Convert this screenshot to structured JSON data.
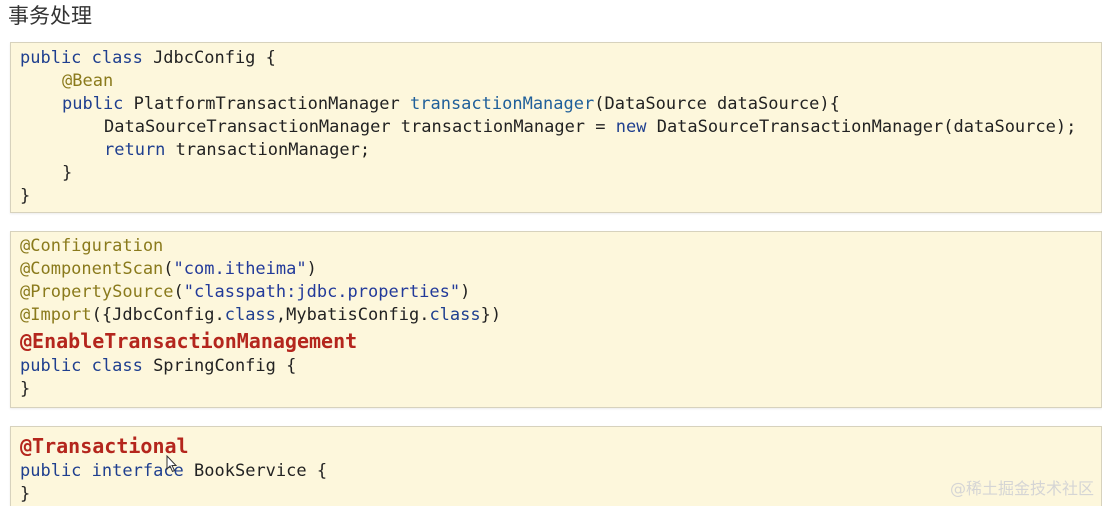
{
  "page": {
    "title": "事务处理",
    "watermark": "@稀土掘金技术社区"
  },
  "block1": {
    "l1_kw": "public class",
    "l1_rest": " JdbcConfig {",
    "l2_ann": "@Bean",
    "l3_kw": "public",
    "l3_type": " PlatformTransactionManager ",
    "l3_method": "transactionManager",
    "l3_rest": "(DataSource dataSource){",
    "l4_a": "DataSourceTransactionManager transactionManager = ",
    "l4_kw": "new",
    "l4_b": " DataSourceTransactionManager(dataSource);",
    "l5_kw": "return",
    "l5_rest": " transactionManager;",
    "l6": "}",
    "l7": "}"
  },
  "block2": {
    "l1_ann": "@Configuration",
    "l2_ann": "@ComponentScan",
    "l2_p1": "(",
    "l2_str": "\"com.itheima\"",
    "l2_p2": ")",
    "l3_ann": "@PropertySource",
    "l3_p1": "(",
    "l3_str": "\"classpath:jdbc.properties\"",
    "l3_p2": ")",
    "l4_ann": "@Import",
    "l4_a": "({JdbcConfig.",
    "l4_kw1": "class",
    "l4_b": ",MybatisConfig.",
    "l4_kw2": "class",
    "l4_c": "})",
    "l5_ann": "@EnableTransactionManagement",
    "l6_kw": "public class",
    "l6_rest": " SpringConfig {",
    "l7": "}"
  },
  "block3": {
    "l1_ann": "@Transactional",
    "l2_kw1": "public",
    "l2_sp": " ",
    "l2_kw2": "interface",
    "l2_rest": " BookService {",
    "l3": "}"
  },
  "colors": {
    "keyword": "#1f3f8f",
    "annotation": "#8a7a1c",
    "string": "#223a9a",
    "highlight_annotation": "#b4261d",
    "block_background": "#fdf7dc"
  }
}
